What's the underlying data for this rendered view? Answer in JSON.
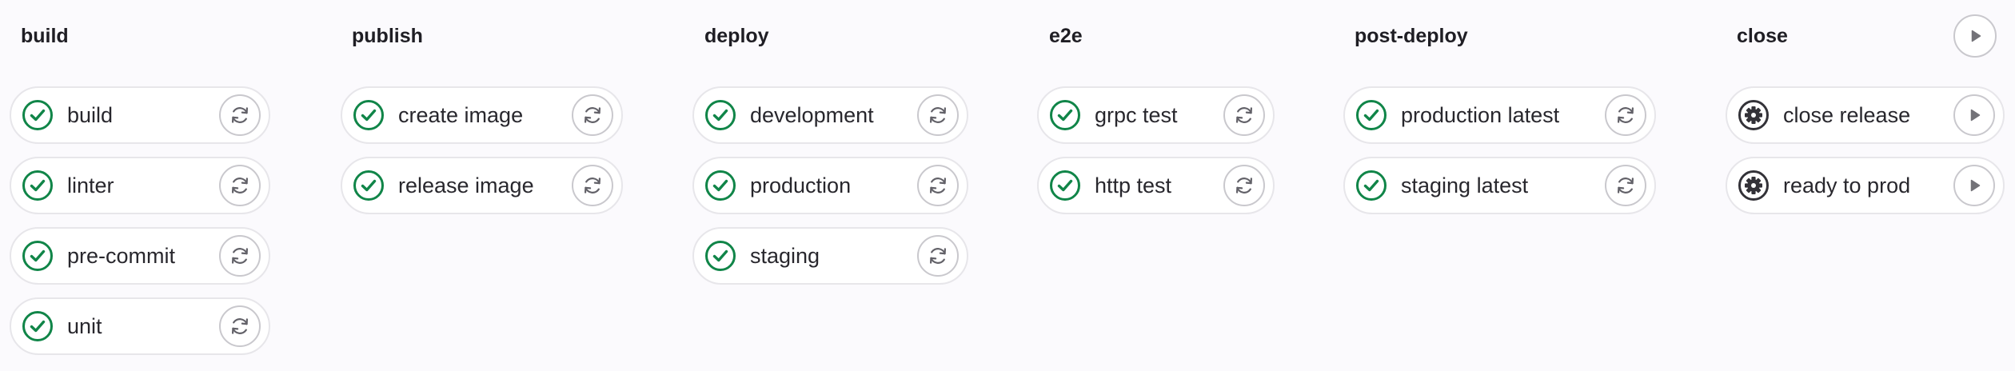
{
  "stages": [
    {
      "title": "build",
      "jobs": [
        {
          "name": "build",
          "status": "success",
          "action": "retry"
        },
        {
          "name": "linter",
          "status": "success",
          "action": "retry"
        },
        {
          "name": "pre-commit",
          "status": "success",
          "action": "retry"
        },
        {
          "name": "unit",
          "status": "success",
          "action": "retry"
        }
      ]
    },
    {
      "title": "publish",
      "jobs": [
        {
          "name": "create image",
          "status": "success",
          "action": "retry"
        },
        {
          "name": "release image",
          "status": "success",
          "action": "retry"
        }
      ]
    },
    {
      "title": "deploy",
      "jobs": [
        {
          "name": "development",
          "status": "success",
          "action": "retry"
        },
        {
          "name": "production",
          "status": "success",
          "action": "retry"
        },
        {
          "name": "staging",
          "status": "success",
          "action": "retry"
        }
      ]
    },
    {
      "title": "e2e",
      "jobs": [
        {
          "name": "grpc test",
          "status": "success",
          "action": "retry"
        },
        {
          "name": "http test",
          "status": "success",
          "action": "retry"
        }
      ]
    },
    {
      "title": "post-deploy",
      "jobs": [
        {
          "name": "production latest",
          "status": "success",
          "action": "retry"
        },
        {
          "name": "staging latest",
          "status": "success",
          "action": "retry"
        }
      ]
    },
    {
      "title": "close",
      "stage_action": "play",
      "jobs": [
        {
          "name": "close release",
          "status": "manual",
          "action": "play"
        },
        {
          "name": "ready to prod",
          "status": "manual",
          "action": "play"
        }
      ]
    }
  ],
  "colors": {
    "success": "#108548",
    "manual": "#333238",
    "action_icon": "#626168",
    "play_icon": "#737278"
  },
  "icons": {
    "success": "status-success-check-icon",
    "manual": "status-manual-gear-icon",
    "retry": "retry-icon",
    "play": "play-icon"
  }
}
